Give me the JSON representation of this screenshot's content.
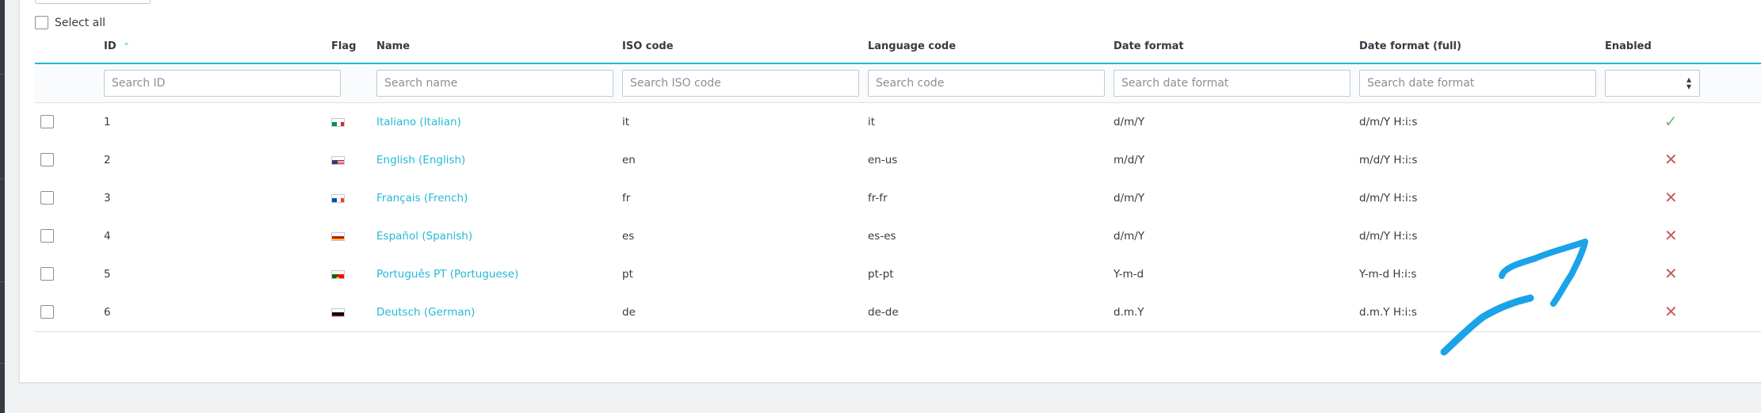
{
  "select_all_label": "Select all",
  "columns": {
    "id": "ID",
    "flag": "Flag",
    "name": "Name",
    "iso": "ISO code",
    "language_code": "Language code",
    "date_format": "Date format",
    "date_format_full": "Date format (full)",
    "enabled": "Enabled"
  },
  "sort": {
    "column": "id",
    "direction": "asc",
    "icon": "sort-ascending-icon"
  },
  "filters": {
    "id": {
      "value": "",
      "placeholder": "Search ID"
    },
    "name": {
      "value": "",
      "placeholder": "Search name"
    },
    "iso": {
      "value": "",
      "placeholder": "Search ISO code"
    },
    "language_code": {
      "value": "",
      "placeholder": "Search code"
    },
    "date_format": {
      "value": "",
      "placeholder": "Search date format"
    },
    "date_format_full": {
      "value": "",
      "placeholder": "Search date format"
    },
    "enabled": {
      "selected": ""
    }
  },
  "rows": [
    {
      "id": "1",
      "flag": "italy",
      "name": "Italiano (Italian)",
      "iso": "it",
      "language_code": "it",
      "date_format": "d/m/Y",
      "date_format_full": "d/m/Y H:i:s",
      "enabled": true
    },
    {
      "id": "2",
      "flag": "usa",
      "name": "English (English)",
      "iso": "en",
      "language_code": "en-us",
      "date_format": "m/d/Y",
      "date_format_full": "m/d/Y H:i:s",
      "enabled": false
    },
    {
      "id": "3",
      "flag": "france",
      "name": "Français (French)",
      "iso": "fr",
      "language_code": "fr-fr",
      "date_format": "d/m/Y",
      "date_format_full": "d/m/Y H:i:s",
      "enabled": false
    },
    {
      "id": "4",
      "flag": "spain",
      "name": "Español (Spanish)",
      "iso": "es",
      "language_code": "es-es",
      "date_format": "d/m/Y",
      "date_format_full": "d/m/Y H:i:s",
      "enabled": false
    },
    {
      "id": "5",
      "flag": "portugal",
      "name": "Português PT (Portuguese)",
      "iso": "pt",
      "language_code": "pt-pt",
      "date_format": "Y-m-d",
      "date_format_full": "Y-m-d H:i:s",
      "enabled": false
    },
    {
      "id": "6",
      "flag": "germany",
      "name": "Deutsch (German)",
      "iso": "de",
      "language_code": "de-de",
      "date_format": "d.m.Y",
      "date_format_full": "d.m.Y H:i:s",
      "enabled": false
    }
  ],
  "icons": {
    "enabled_true": "check-icon",
    "enabled_false": "cross-icon",
    "select_caret": "sort-caret-icon"
  },
  "colors": {
    "accent": "#25b9d7",
    "enabled": "#70b580",
    "disabled": "#c45c5c",
    "annotation": "#1aa3e8"
  }
}
